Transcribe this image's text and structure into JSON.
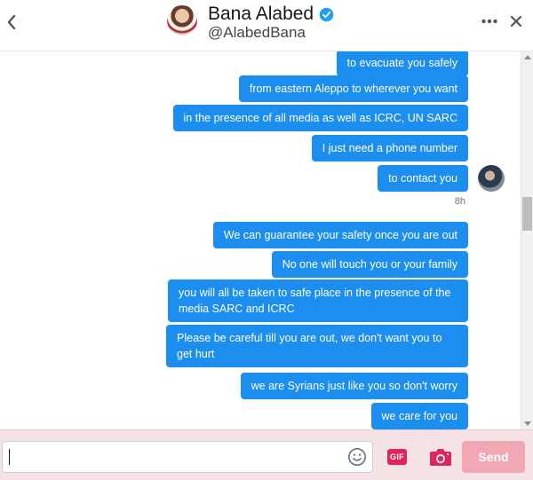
{
  "header": {
    "name": "Bana Alabed",
    "handle": "@AlabedBana"
  },
  "messages": [
    {
      "text": "to evacuate you safely"
    },
    {
      "text": "from eastern Aleppo to wherever you want"
    },
    {
      "text": "in the presence of all media as well as ICRC, UN SARC"
    },
    {
      "text": "I just need a phone number"
    },
    {
      "text": "to contact you"
    },
    {
      "text": "We can guarantee your safety once you are out"
    },
    {
      "text": "No one will touch you or your family"
    },
    {
      "text": "you will all be taken to safe place in the presence of the media SARC and ICRC"
    },
    {
      "text": "Please be careful till you are out, we don't want you to get hurt"
    },
    {
      "text": "we are Syrians just like you so don't worry"
    },
    {
      "text": "we care for you"
    }
  ],
  "timestamp": "8h",
  "compose": {
    "placeholder": "",
    "gif_label": "GIF",
    "send_label": "Send"
  },
  "icons": {
    "back": "chevron-left-icon",
    "verified": "verified-badge-icon",
    "more": "more-horizontal-icon",
    "close": "close-icon",
    "emoji": "emoji-icon",
    "camera": "camera-icon"
  },
  "colors": {
    "bubble": "#1c8ef0",
    "accent": "#1da1f2",
    "send_disabled": "#f2a7b5",
    "gif": "#e0245e",
    "compose_bg": "#f6e3e6"
  }
}
